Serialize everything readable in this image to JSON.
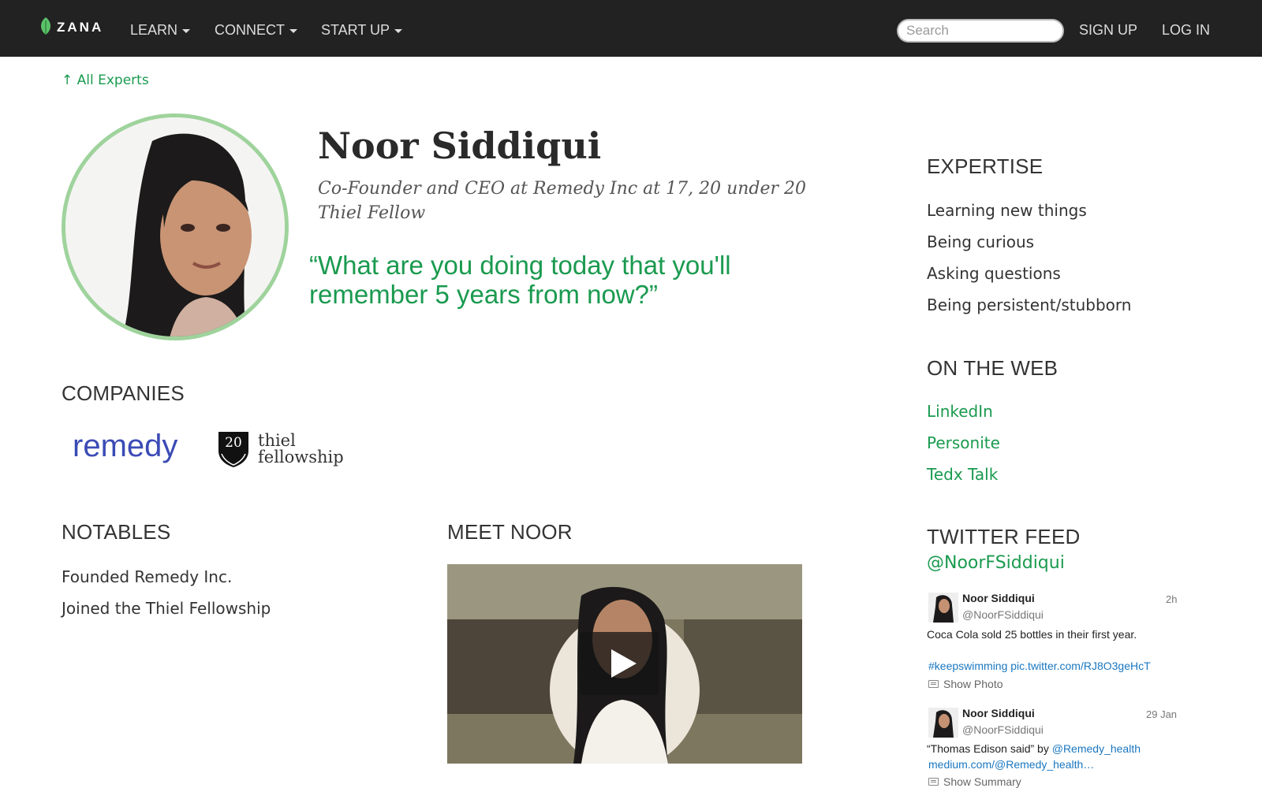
{
  "nav": {
    "logo": "ZANA",
    "items": [
      "LEARN",
      "CONNECT",
      "START UP"
    ],
    "search_placeholder": "Search",
    "signup": "SIGN UP",
    "login": "LOG IN"
  },
  "back_link": "↑ All Experts",
  "profile": {
    "name": "Noor Siddiqui",
    "title": "Co-Founder and CEO at Remedy Inc at 17, 20 under 20 Thiel Fellow",
    "quote": "“What are you doing today that you'll remember 5 years from now?”"
  },
  "companies": {
    "heading": "COMPANIES",
    "remedy": "remedy",
    "thiel_badge": "20",
    "thiel_line1": "thiel",
    "thiel_line2": "fellowship"
  },
  "notables": {
    "heading": "NOTABLES",
    "items": [
      "Founded Remedy Inc.",
      "Joined the Thiel Fellowship"
    ]
  },
  "meet": {
    "heading": "MEET NOOR"
  },
  "expertise": {
    "heading": "EXPERTISE",
    "items": [
      "Learning new things",
      "Being curious",
      "Asking questions",
      "Being persistent/stubborn"
    ]
  },
  "web": {
    "heading": "ON THE WEB",
    "links": [
      "LinkedIn",
      "Personite",
      "Tedx Talk"
    ]
  },
  "twitter": {
    "heading": "TWITTER FEED",
    "handle": "@NoorFSiddiqui",
    "tweets": [
      {
        "name": "Noor Siddiqui",
        "handle": "@NoorFSiddiqui",
        "time": "2h",
        "text": "Coca Cola sold 25 bottles in their first year.",
        "link": "#keepswimming pic.twitter.com/RJ8O3geHcT",
        "action": "Show Photo"
      },
      {
        "name": "Noor Siddiqui",
        "handle": "@NoorFSiddiqui",
        "time": "29 Jan",
        "text_prefix": "“Thomas Edison said” by ",
        "mention": "@Remedy_health",
        "link": "medium.com/@Remedy_health…",
        "action": "Show Summary"
      }
    ]
  },
  "colors": {
    "accent": "#1a9a4f",
    "nav_bg": "#222222",
    "avatar_ring": "#9fd39c",
    "remedy": "#3b4bb5",
    "tweet_link": "#1a77c0"
  }
}
